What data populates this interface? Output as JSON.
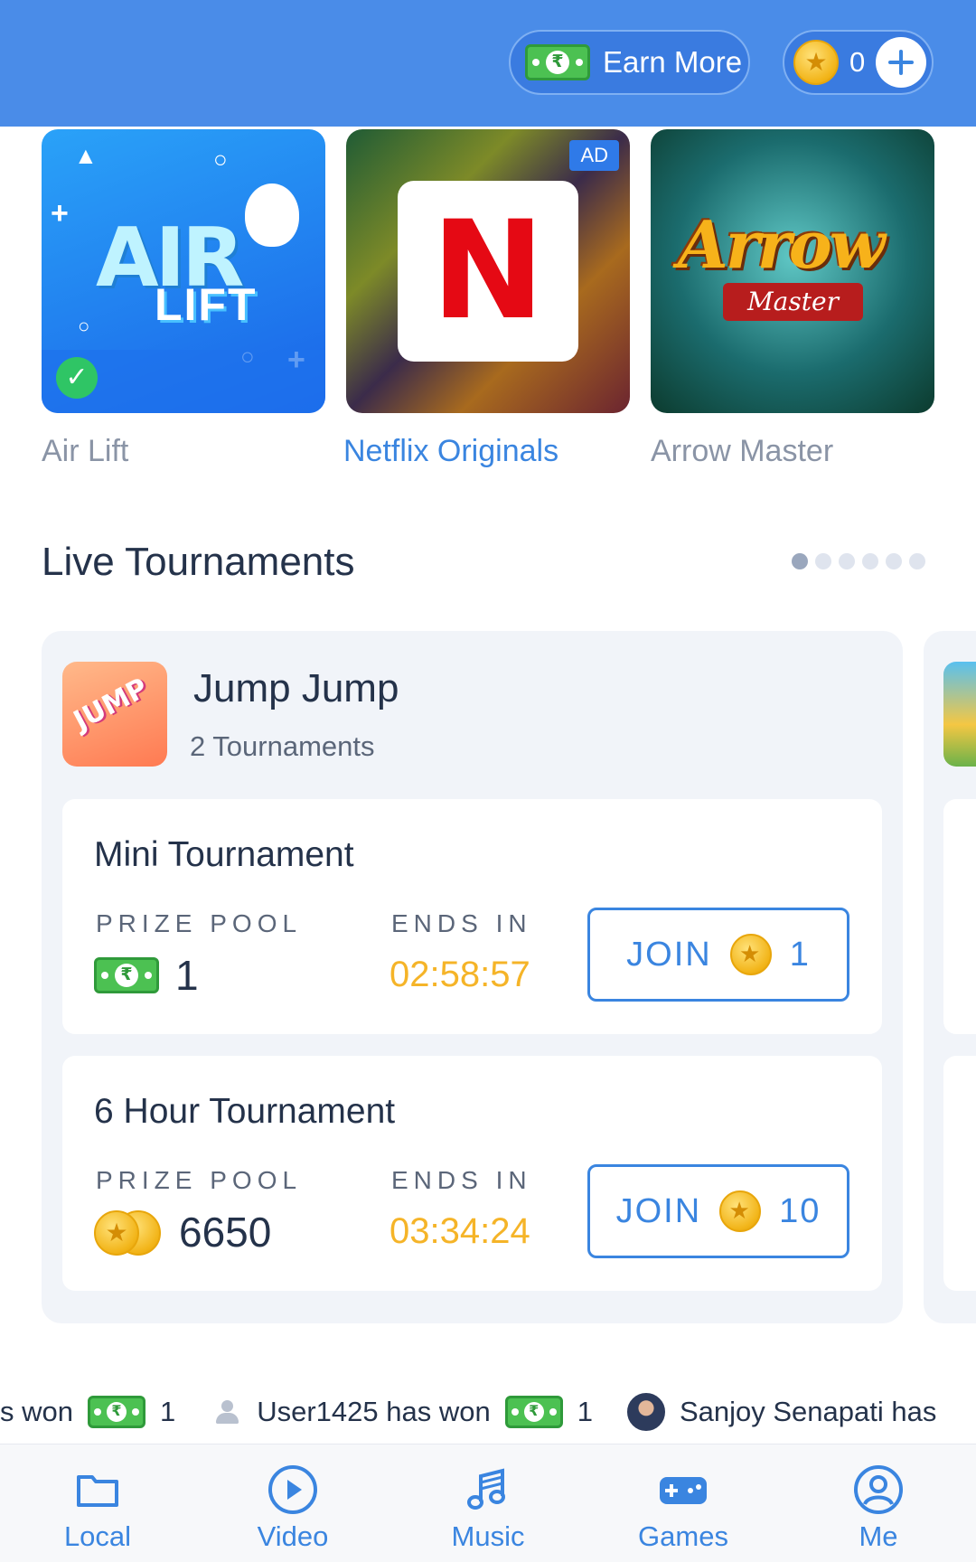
{
  "header": {
    "earn_more_label": "Earn More",
    "coin_count": "0"
  },
  "games": [
    {
      "name": "Air Lift",
      "logo_text_1": "AIR",
      "logo_text_2": "LIFT"
    },
    {
      "name": "Netflix Originals",
      "badge": "AD",
      "logo_text": "N"
    },
    {
      "name": "Arrow Master",
      "logo_text_1": "Arrow",
      "logo_text_2": "Master"
    }
  ],
  "live_tournaments": {
    "title": "Live Tournaments",
    "pager_pages": 6,
    "pager_active": 1,
    "game": {
      "name": "Jump Jump",
      "count_label": "2 Tournaments",
      "icon_text": "JUMP"
    },
    "tournaments": [
      {
        "name": "Mini Tournament",
        "prize_pool_label": "PRIZE POOL",
        "prize_icon": "cash-icon",
        "prize_value": "1",
        "ends_in_label": "ENDS IN",
        "ends_in": "02:58:57",
        "join_label": "JOIN",
        "join_cost": "1"
      },
      {
        "name": "6 Hour Tournament",
        "prize_pool_label": "PRIZE POOL",
        "prize_icon": "coin-icon",
        "prize_value": "6650",
        "ends_in_label": "ENDS IN",
        "ends_in": "03:34:24",
        "join_label": "JOIN",
        "join_cost": "10"
      }
    ]
  },
  "ticker": [
    {
      "text": "s won",
      "amount": "1"
    },
    {
      "text": "User1425 has won",
      "amount": "1"
    },
    {
      "text": "Sanjoy Senapati has"
    }
  ],
  "nav": [
    {
      "label": "Local",
      "icon": "folder-icon"
    },
    {
      "label": "Video",
      "icon": "play-icon"
    },
    {
      "label": "Music",
      "icon": "music-icon"
    },
    {
      "label": "Games",
      "icon": "gamepad-icon"
    },
    {
      "label": "Me",
      "icon": "profile-icon"
    }
  ],
  "colors": {
    "header": "#4a8ce8",
    "accent": "#3a85e0",
    "timer": "#f5b428",
    "cash": "#4cc152",
    "coin": "#f2b418"
  }
}
